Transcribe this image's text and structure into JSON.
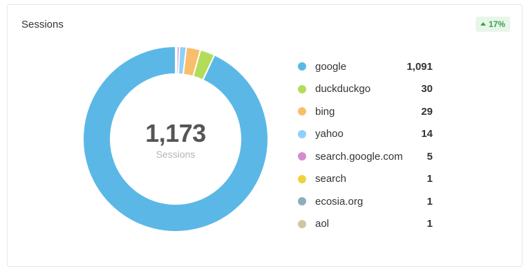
{
  "card": {
    "title": "Sessions",
    "change": "17%",
    "change_direction": "up"
  },
  "total": {
    "value": "1,173",
    "label": "Sessions"
  },
  "colors": {
    "accent_up": "#38a04c",
    "badge_bg": "#e8f6e9"
  },
  "chart_data": {
    "type": "pie",
    "donut": true,
    "categories": [
      "google",
      "duckduckgo",
      "bing",
      "yahoo",
      "search.google.com",
      "search",
      "ecosia.org",
      "aol"
    ],
    "values": [
      1091,
      30,
      29,
      14,
      5,
      1,
      1,
      1
    ],
    "value_labels": [
      "1,091",
      "30",
      "29",
      "14",
      "5",
      "1",
      "1",
      "1"
    ],
    "colors": [
      "#5bb8e6",
      "#b3dc5a",
      "#f8be6b",
      "#8ed1fb",
      "#d48ccf",
      "#f0d23c",
      "#8eaebf",
      "#cfc6a4"
    ],
    "legend_position": "right"
  }
}
